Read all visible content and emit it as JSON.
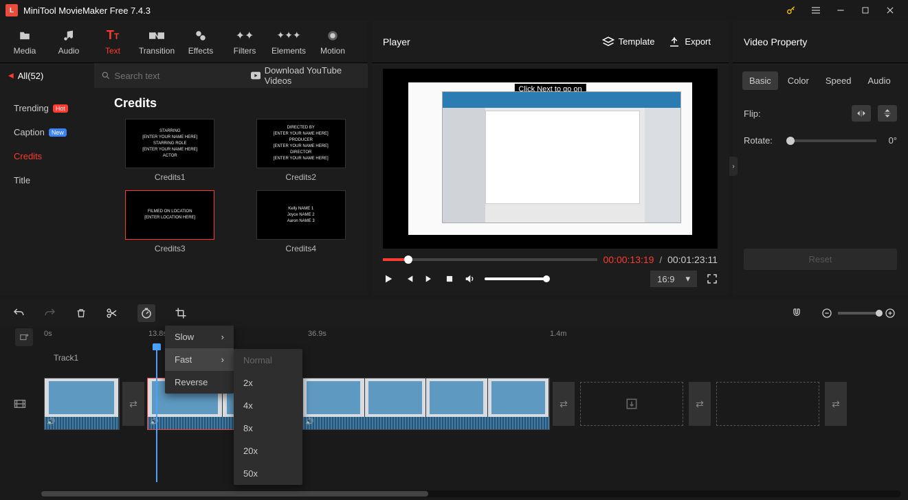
{
  "title": "MiniTool MovieMaker Free 7.4.3",
  "topTabs": [
    {
      "label": "Media"
    },
    {
      "label": "Audio"
    },
    {
      "label": "Text",
      "active": true
    },
    {
      "label": "Transition"
    },
    {
      "label": "Effects"
    },
    {
      "label": "Filters"
    },
    {
      "label": "Elements"
    },
    {
      "label": "Motion"
    }
  ],
  "filterAll": "All(52)",
  "searchPlaceholder": "Search text",
  "downloadLink": "Download YouTube Videos",
  "categories": [
    {
      "label": "Trending",
      "badge": "Hot",
      "badgeClass": "hot"
    },
    {
      "label": "Caption",
      "badge": "New",
      "badgeClass": "new"
    },
    {
      "label": "Credits",
      "active": true
    },
    {
      "label": "Title"
    }
  ],
  "gridTitle": "Credits",
  "thumbs": [
    {
      "label": "Credits1",
      "lines": [
        "STARRING",
        "[ENTER YOUR NAME HERE]",
        "STARRING ROLE",
        "[ENTER YOUR NAME HERE]",
        "ACTOR"
      ]
    },
    {
      "label": "Credits2",
      "lines": [
        "DIRECTED BY",
        "[ENTER YOUR NAME HERE]",
        "PRODUCER",
        "[ENTER YOUR NAME HERE]",
        "DIRECTOR",
        "[ENTER YOUR NAME HERE]"
      ]
    },
    {
      "label": "Credits3",
      "selected": true,
      "lines": [
        "FILMED ON LOCATION",
        "[ENTER LOCATION HERE]"
      ]
    },
    {
      "label": "Credits4",
      "lines": [
        "Kelly NAME 1",
        "Joyce NAME 2",
        "Aaron NAME 3"
      ]
    }
  ],
  "player": {
    "title": "Player",
    "template": "Template",
    "export": "Export",
    "overlay": "Click Next to go on",
    "current": "00:00:13:19",
    "total": "00:01:23:11",
    "aspect": "16:9"
  },
  "props": {
    "title": "Video Property",
    "tabs": [
      "Basic",
      "Color",
      "Speed",
      "Audio"
    ],
    "flip": "Flip:",
    "rotate": "Rotate:",
    "rotateVal": "0°",
    "reset": "Reset"
  },
  "ruler": {
    "t0": "0s",
    "t1": "13.8s",
    "t2": "36.9s",
    "t3": "1.4m"
  },
  "track": "Track1",
  "speedMenu": [
    "Slow",
    "Fast",
    "Reverse"
  ],
  "speedSub": [
    "Normal",
    "2x",
    "4x",
    "8x",
    "20x",
    "50x"
  ]
}
